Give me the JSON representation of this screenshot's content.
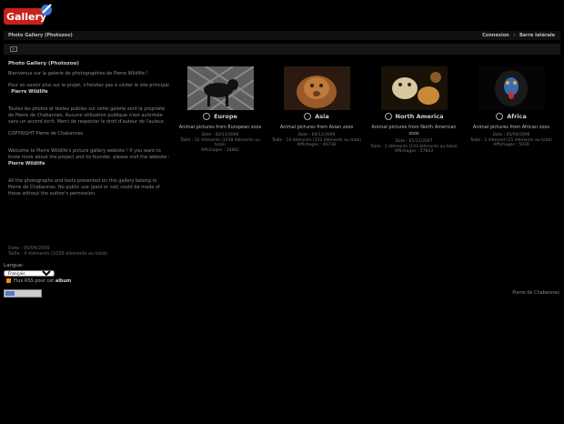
{
  "header": {
    "logo_text": "Gallery",
    "title": "Photo Gallery (Photozoo)",
    "links": [
      "Connexion",
      "Barre latérale"
    ],
    "separator": "»"
  },
  "intro": {
    "heading": "Photo Gallery (Photozoo)",
    "p1": "Bienvenue sur la galerie de photographies de Pierre Wildlife !",
    "p2_text": "Pour en savoir plus sur le projet, n'hésitez pas à visiter le site principal :",
    "p2_link": "Pierre Wildlife",
    "p3": "Toutes les photos et textes publiés sur cette galerie sont la propriété de Pierre de Chabannes. Aucune utilisation publique n'est autorisée sans un accord écrit. Merci de respecter le droit d'auteur de l'auteur.",
    "p4": "COPYRIGHT Pierre de Chabannes",
    "p5_text": "Welcome to Pierre Wildlife's picture gallery website ! If you want to know more about the project and its founder, please visit the website :",
    "p5_link": "Pierre Wildlife",
    "p6": "All the photographs and texts presented on this gallery belong to Pierre de Chabannes. No public use (paid or not) could be made of these without the author's permission."
  },
  "meta": {
    "line1": "Date : 05/04/2006",
    "line2": "Taille : 4 éléments (1039 éléments au total)"
  },
  "language": {
    "label": "Langue:",
    "selected": "Français"
  },
  "rss": {
    "prefix": "Flux RSS pour cet",
    "link": "album"
  },
  "footer": {
    "right": "Pierre de Chabannes"
  },
  "albums": [
    {
      "title": "Europe",
      "desc": "Animal pictures from European zoos",
      "meta1": "Date : 02/11/2006",
      "meta2": "Taille : 31 éléments (1038 éléments au total)",
      "meta3": "Affichages : 34961"
    },
    {
      "title": "Asia",
      "desc": "Animal pictures from Asian zoos",
      "meta1": "Date : 04/11/2009",
      "meta2": "Taille : 14 éléments (312 éléments au total)",
      "meta3": "Affichages : 46738"
    },
    {
      "title": "North America",
      "desc": "Animal pictures from North American zoos",
      "meta1": "Date : 01/11/2007",
      "meta2": "Taille : 2 éléments (143 éléments au total)",
      "meta3": "Affichages : 57843"
    },
    {
      "title": "Africa",
      "desc": "Animal pictures from African zoos",
      "meta1": "Date : 05/04/2006",
      "meta2": "Taille : 1 élément (15 éléments au total)",
      "meta3": "Affichages : 5039"
    }
  ],
  "colors": {
    "background": "#000000",
    "bar": "#111111",
    "text": "#8a8a8a",
    "link": "#bdbdbd"
  }
}
